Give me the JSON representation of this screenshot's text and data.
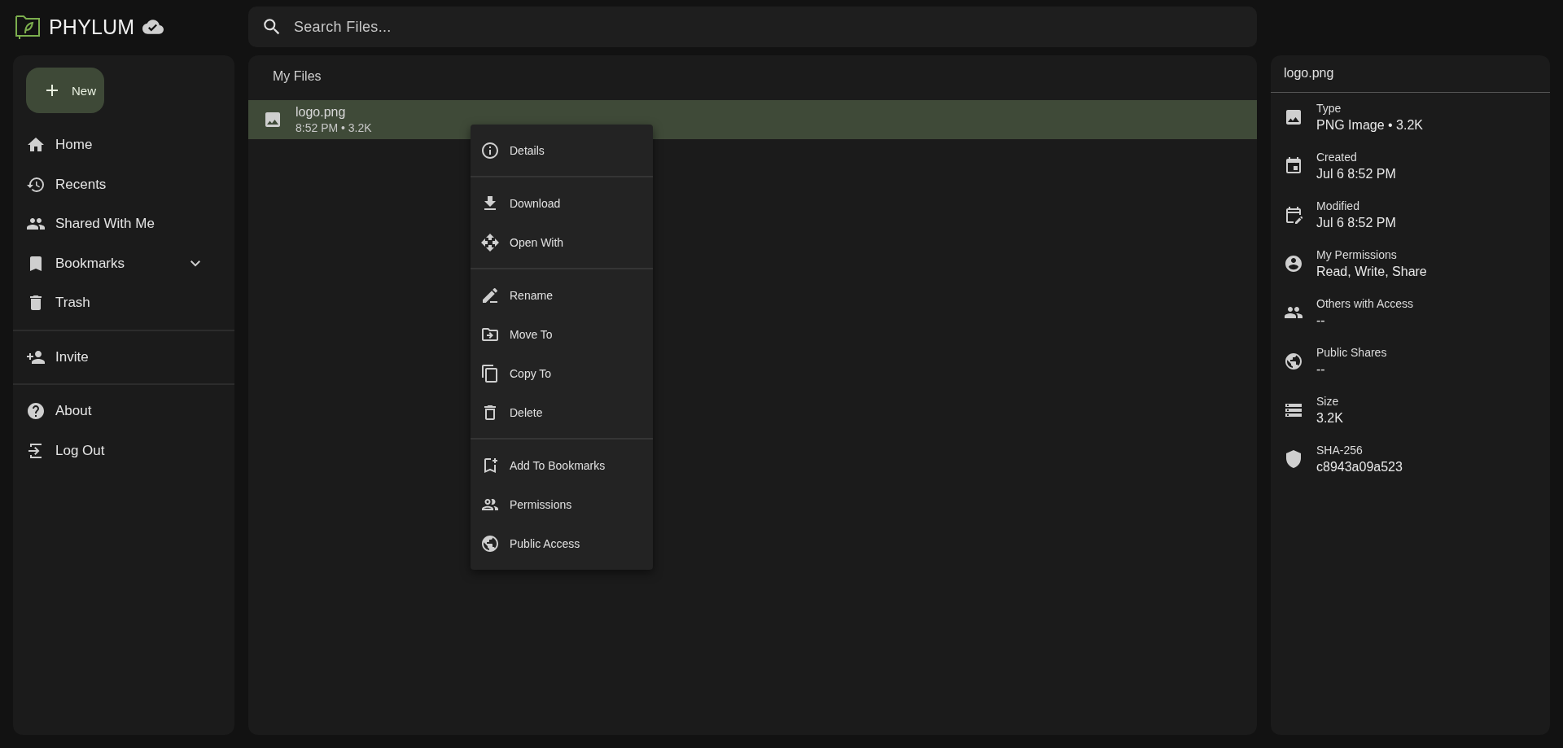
{
  "app": {
    "name": "PHYLUM"
  },
  "search": {
    "placeholder": "Search Files..."
  },
  "sidebar": {
    "new_button": "New",
    "sections": [
      [
        {
          "label": "Home",
          "selected": false
        },
        {
          "label": "Recents",
          "selected": false
        },
        {
          "label": "Shared With Me",
          "selected": false
        },
        {
          "label": "Bookmarks",
          "selected": false,
          "expanded": false
        },
        {
          "label": "Trash",
          "selected": false
        }
      ],
      [
        {
          "label": "Invite",
          "selected": false
        }
      ],
      [
        {
          "label": "About",
          "selected": false
        },
        {
          "label": "Log Out",
          "selected": false
        }
      ]
    ]
  },
  "main": {
    "title": "My Files",
    "files": [
      {
        "name": "logo.png",
        "meta": "8:52 PM • 3.2K",
        "selected": true
      }
    ]
  },
  "context_menu": {
    "groups": [
      [
        "Details"
      ],
      [
        "Download",
        "Open With"
      ],
      [
        "Rename",
        "Move To",
        "Copy To",
        "Delete"
      ],
      [
        "Add To Bookmarks",
        "Permissions",
        "Public Access"
      ]
    ]
  },
  "details": {
    "title": "logo.png",
    "fields": [
      {
        "label": "Type",
        "value": "PNG Image • 3.2K"
      },
      {
        "label": "Created",
        "value": "Jul 6 8:52 PM"
      },
      {
        "label": "Modified",
        "value": "Jul 6 8:52 PM"
      },
      {
        "label": "My Permissions",
        "value": "Read, Write, Share"
      },
      {
        "label": "Others with Access",
        "value": "--"
      },
      {
        "label": "Public Shares",
        "value": "--"
      },
      {
        "label": "Size",
        "value": "3.2K"
      },
      {
        "label": "SHA-256",
        "value": "c8943a09a523"
      }
    ]
  }
}
